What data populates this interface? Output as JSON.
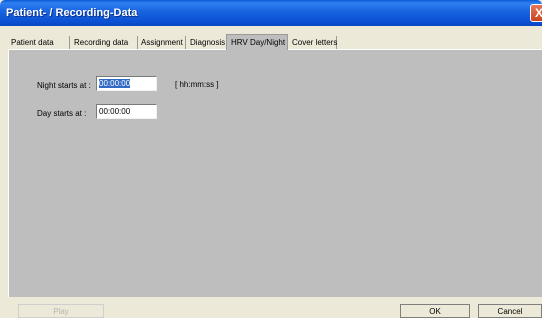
{
  "window": {
    "title": "Patient- / Recording-Data",
    "close_glyph": "X"
  },
  "tabs": [
    {
      "label": "Patient data",
      "active": false
    },
    {
      "label": "Recording data",
      "active": false
    },
    {
      "label": "Assignment",
      "active": false
    },
    {
      "label": "Diagnosis",
      "active": false
    },
    {
      "label": "HRV Day/Night",
      "active": true
    },
    {
      "label": "Cover letters",
      "active": false
    }
  ],
  "form": {
    "night_label": "Night starts at :",
    "night_value": "00:00:00",
    "format_hint": "[ hh:mm:ss ]",
    "day_label": "Day starts at :",
    "day_value": "00:00:00"
  },
  "buttons": {
    "play": "Play",
    "ok": "OK",
    "cancel": "Cancel"
  },
  "colors": {
    "titlebar": "#0b4fd2",
    "panel": "#bebebe",
    "selection": "#316ac5"
  }
}
